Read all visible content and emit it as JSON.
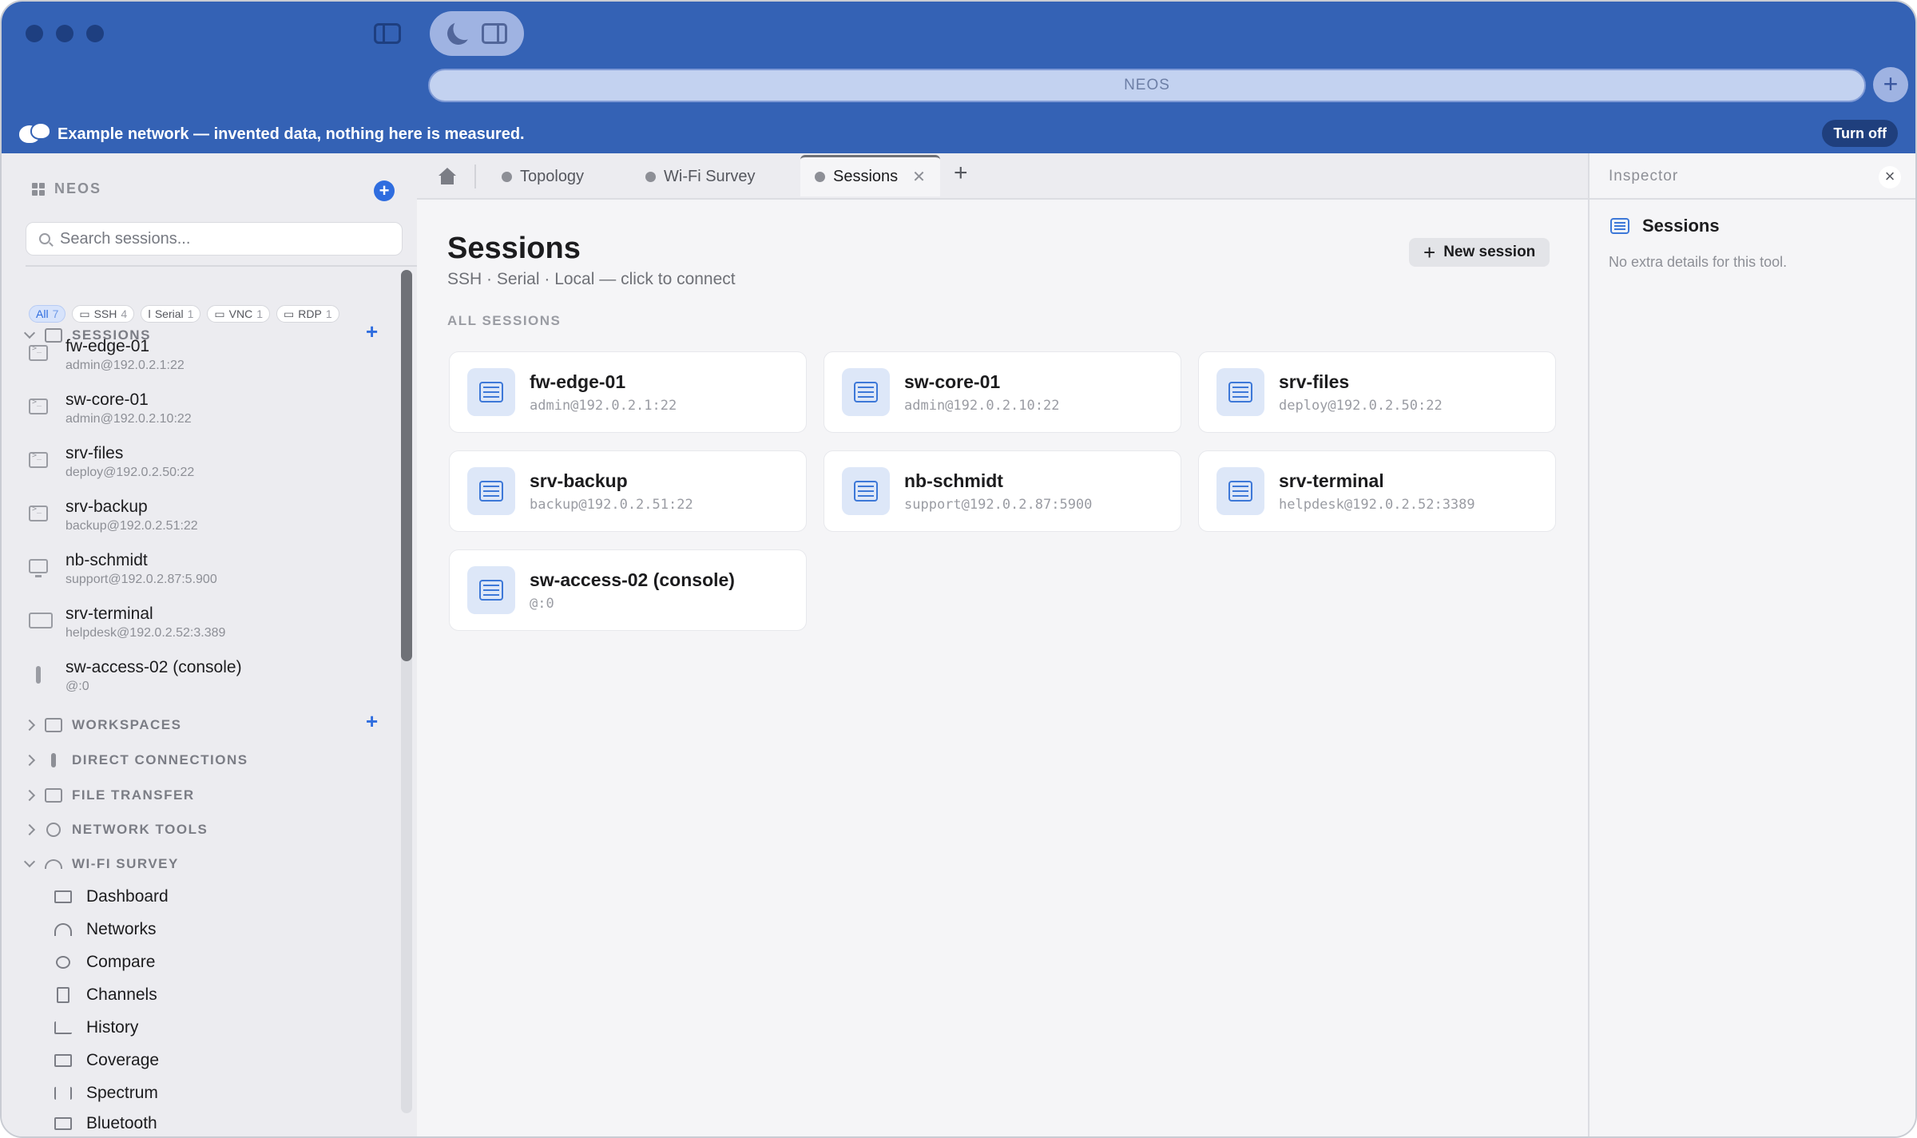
{
  "titlebar": {
    "address": "NEOS",
    "demo_banner": "Example network — invented data, nothing here is measured.",
    "turn_off_label": "Turn off"
  },
  "sidebar": {
    "title": "NEOS",
    "search_placeholder": "Search sessions...",
    "sessions_label": "SESSIONS",
    "filters": [
      {
        "label": "All",
        "count": "7",
        "active": true
      },
      {
        "label": "SSH",
        "count": "4"
      },
      {
        "label": "Serial",
        "count": "1"
      },
      {
        "label": "VNC",
        "count": "1"
      },
      {
        "label": "RDP",
        "count": "1"
      }
    ],
    "sessions": [
      {
        "name": "fw-edge-01",
        "addr": "admin@192.0.2.1:22",
        "icon": "terminal-icon"
      },
      {
        "name": "sw-core-01",
        "addr": "admin@192.0.2.10:22",
        "icon": "terminal-icon"
      },
      {
        "name": "srv-files",
        "addr": "deploy@192.0.2.50:22",
        "icon": "terminal-icon"
      },
      {
        "name": "srv-backup",
        "addr": "backup@192.0.2.51:22",
        "icon": "terminal-icon"
      },
      {
        "name": "nb-schmidt",
        "addr": "support@192.0.2.87:5.900",
        "icon": "monitor-icon"
      },
      {
        "name": "srv-terminal",
        "addr": "helpdesk@192.0.2.52:3.389",
        "icon": "remote-desktop-icon"
      },
      {
        "name": "sw-access-02 (console)",
        "addr": "@:0",
        "icon": "console-cable-icon"
      }
    ],
    "sections": [
      {
        "label": "WORKSPACES",
        "icon": "workspaces-icon"
      },
      {
        "label": "DIRECT CONNECTIONS",
        "icon": "cable-icon"
      },
      {
        "label": "FILE TRANSFER",
        "icon": "file-transfer-icon"
      },
      {
        "label": "NETWORK TOOLS",
        "icon": "antenna-icon"
      },
      {
        "label": "WI-FI SURVEY",
        "icon": "wifi-icon"
      }
    ],
    "wifi_items": [
      "Dashboard",
      "Networks",
      "Compare",
      "Channels",
      "History",
      "Coverage",
      "Spectrum",
      "Bluetooth"
    ]
  },
  "tabs": [
    {
      "label": "Topology"
    },
    {
      "label": "Wi-Fi Survey"
    },
    {
      "label": "Sessions",
      "active": true
    }
  ],
  "main": {
    "title": "Sessions",
    "subtitle": "SSH · Serial · Local — click to connect",
    "new_session_label": "New session",
    "section_label": "ALL SESSIONS",
    "cards": [
      {
        "name": "fw-edge-01",
        "addr": "admin@192.0.2.1:22"
      },
      {
        "name": "sw-core-01",
        "addr": "admin@192.0.2.10:22"
      },
      {
        "name": "srv-files",
        "addr": "deploy@192.0.2.50:22"
      },
      {
        "name": "srv-backup",
        "addr": "backup@192.0.2.51:22"
      },
      {
        "name": "nb-schmidt",
        "addr": "support@192.0.2.87:5900"
      },
      {
        "name": "srv-terminal",
        "addr": "helpdesk@192.0.2.52:3389"
      },
      {
        "name": "sw-access-02 (console)",
        "addr": "@:0"
      }
    ]
  },
  "inspector": {
    "title": "Inspector",
    "tool_name": "Sessions",
    "note": "No extra details for this tool."
  },
  "colors": {
    "titlebar": "#3462b5",
    "accent": "#2f6ddf",
    "card_icon_bg": "#dde7f8"
  }
}
